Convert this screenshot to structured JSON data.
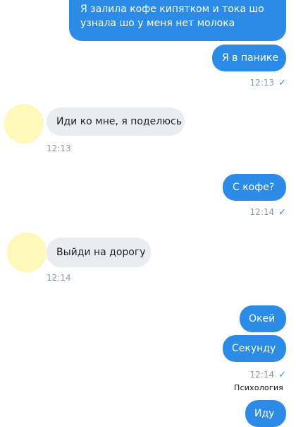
{
  "messages": [
    {
      "lines": [
        "Я залила кофе кипятком и тока шо",
        "узнала шо у меня нет молока"
      ]
    },
    {
      "text": "Я в панике",
      "time": "12:13"
    },
    {
      "text": "Иди ко мне, я поделюсь",
      "time": "12:13"
    },
    {
      "text": "С кофе?",
      "time": "12:14"
    },
    {
      "text": "Выйди на дорогу",
      "time": "12:14"
    },
    {
      "text": "Окей"
    },
    {
      "text": "Секунду",
      "time": "12:14"
    },
    {
      "text": "Иду"
    }
  ],
  "read_check": "✓",
  "watermark": "Психология",
  "colors": {
    "outgoing_bubble": "#2b8be6",
    "incoming_bubble": "#e9edf1",
    "avatar": "#fff8b8",
    "time_text": "#8a98a6"
  }
}
